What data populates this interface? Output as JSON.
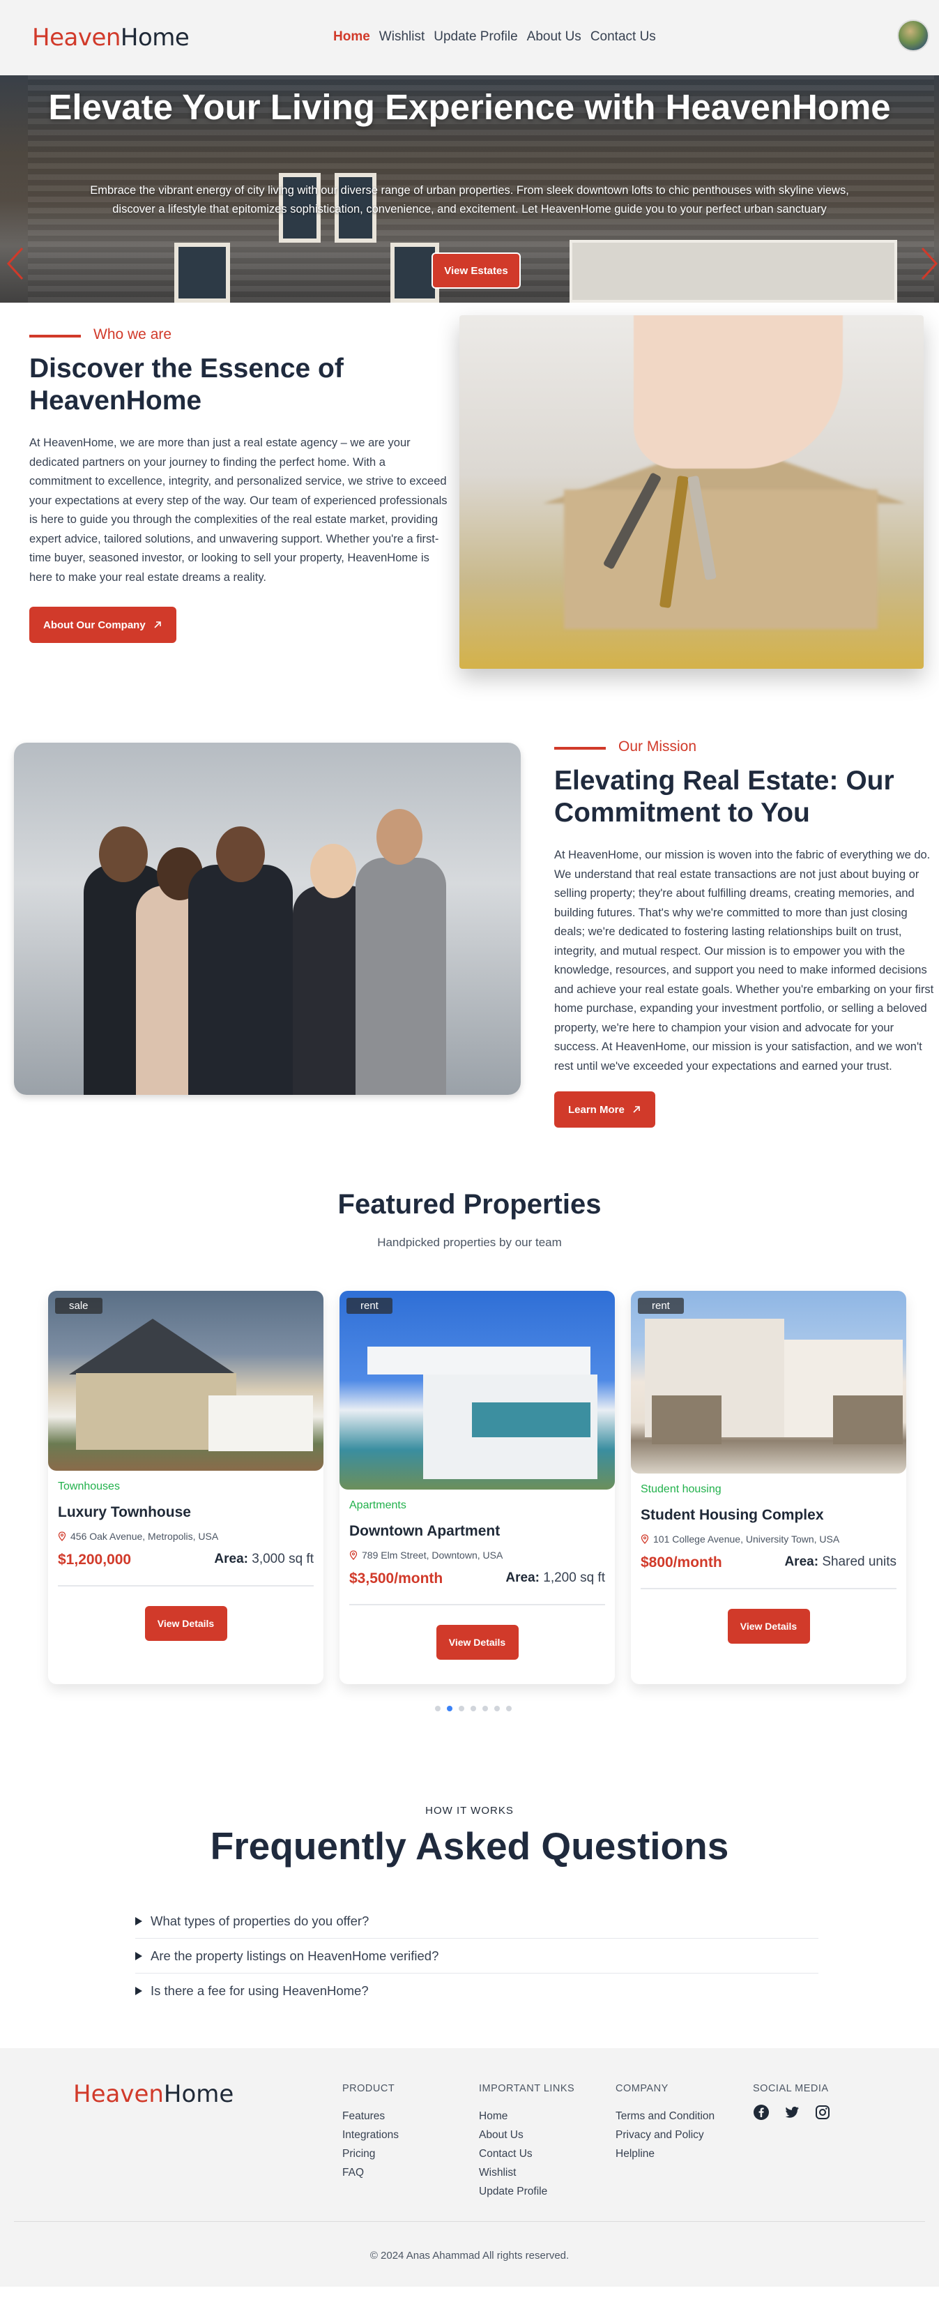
{
  "brand": {
    "part1": "Heaven",
    "part2": "Home"
  },
  "nav": {
    "links": [
      "Home",
      "Wishlist",
      "Update Profile",
      "About Us",
      "Contact Us"
    ],
    "active": "Home"
  },
  "hero": {
    "title": "Elevate Your Living Experience with HeavenHome",
    "text": "Embrace the vibrant energy of city living with our diverse range of urban properties. From sleek downtown lofts to chic penthouses with skyline views, discover a lifestyle that epitomizes sophistication, convenience, and excitement. Let HeavenHome guide you to your perfect urban sanctuary",
    "button": "View Estates"
  },
  "about": {
    "eyebrow": "Who we are",
    "title": "Discover the Essence of HeavenHome",
    "text": "At HeavenHome, we are more than just a real estate agency – we are your dedicated partners on your journey to finding the perfect home. With a commitment to excellence, integrity, and personalized service, we strive to exceed your expectations at every step of the way. Our team of experienced professionals is here to guide you through the complexities of the real estate market, providing expert advice, tailored solutions, and unwavering support. Whether you're a first-time buyer, seasoned investor, or looking to sell your property, HeavenHome is here to make your real estate dreams a reality.",
    "button": "About Our Company"
  },
  "mission": {
    "eyebrow": "Our Mission",
    "title": "Elevating Real Estate: Our Commitment to You",
    "text": "At HeavenHome, our mission is woven into the fabric of everything we do. We understand that real estate transactions are not just about buying or selling property; they're about fulfilling dreams, creating memories, and building futures. That's why we're committed to more than just closing deals; we're dedicated to fostering lasting relationships built on trust, integrity, and mutual respect. Our mission is to empower you with the knowledge, resources, and support you need to make informed decisions and achieve your real estate goals. Whether you're embarking on your first home purchase, expanding your investment portfolio, or selling a beloved property, we're here to champion your vision and advocate for your success. At HeavenHome, our mission is your satisfaction, and we won't rest until we've exceeded your expectations and earned your trust.",
    "button": "Learn More"
  },
  "featured": {
    "title": "Featured Properties",
    "subtitle": "Handpicked properties by our team",
    "area_label": "Area:",
    "button": "View Details",
    "cards": [
      {
        "tag": "sale",
        "category": "Townhouses",
        "name": "Luxury Townhouse",
        "address": "456 Oak Avenue, Metropolis, USA",
        "price": "$1,200,000",
        "area": "3,000 sq ft"
      },
      {
        "tag": "rent",
        "category": "Apartments",
        "name": "Downtown Apartment",
        "address": "789 Elm Street, Downtown, USA",
        "price": "$3,500/month",
        "area": "1,200 sq ft"
      },
      {
        "tag": "rent",
        "category": "Student housing",
        "name": "Student Housing Complex",
        "address": "101 College Avenue, University Town, USA",
        "price": "$800/month",
        "area": "Shared units"
      }
    ],
    "active_dot": 1,
    "dot_count": 7
  },
  "faq": {
    "eyebrow": "HOW IT WORKS",
    "title": "Frequently Asked Questions",
    "items": [
      "What types of properties do you offer?",
      "Are the property listings on HeavenHome verified?",
      "Is there a fee for using HeavenHome?"
    ]
  },
  "footer": {
    "columns": [
      {
        "heading": "PRODUCT",
        "links": [
          "Features",
          "Integrations",
          "Pricing",
          "FAQ"
        ]
      },
      {
        "heading": "IMPORTANT LINKS",
        "links": [
          "Home",
          "About Us",
          "Contact Us",
          "Wishlist",
          "Update Profile"
        ]
      },
      {
        "heading": "COMPANY",
        "links": [
          "Terms and Condition",
          "Privacy and Policy",
          "Helpline"
        ]
      }
    ],
    "social_heading": "SOCIAL MEDIA",
    "social_icons": [
      "facebook-icon",
      "twitter-icon",
      "instagram-icon"
    ],
    "copyright": "© 2024 Anas Ahammad All rights reserved."
  },
  "colors": {
    "accent": "#d13a2a",
    "green": "#22b14c",
    "dark": "#1f2a3d",
    "dot_active": "#3b82f6"
  }
}
